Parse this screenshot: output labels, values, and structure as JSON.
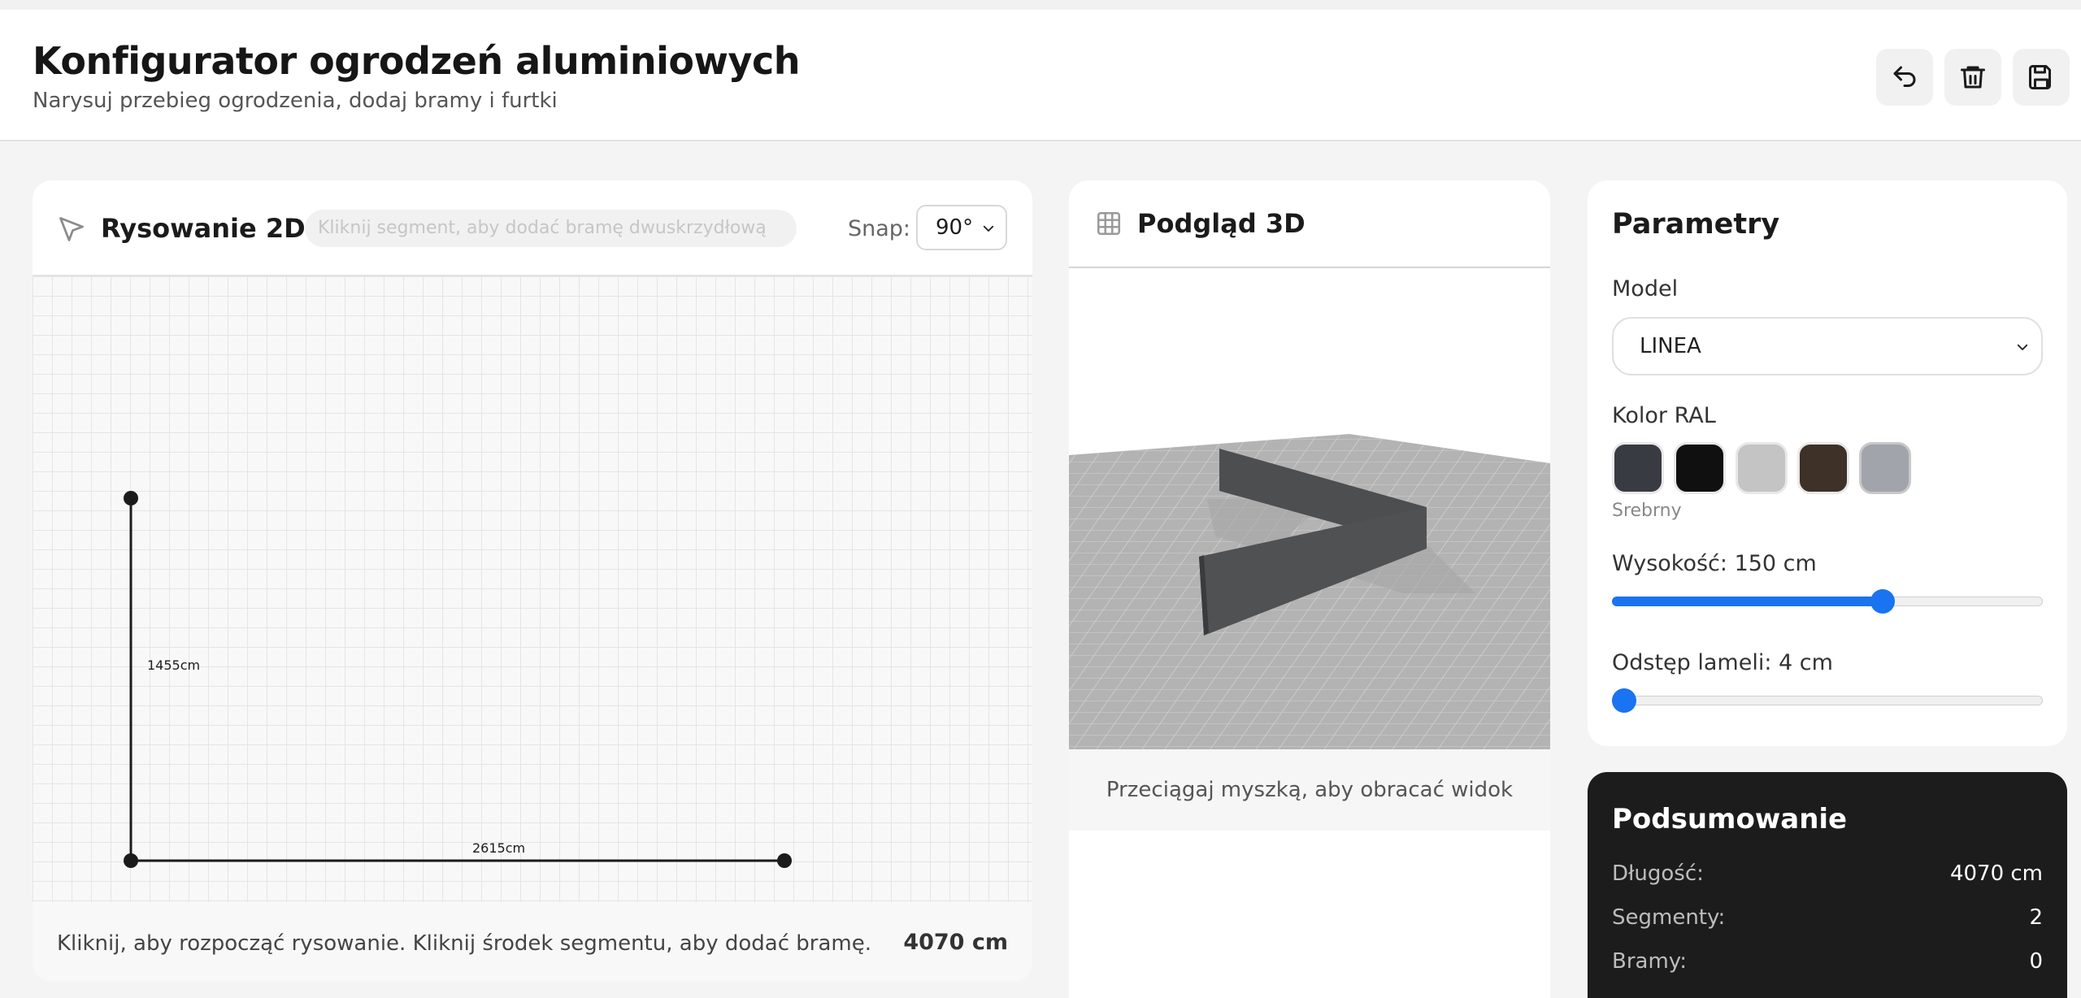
{
  "header": {
    "title": "Konfigurator ogrodzeń aluminiowych",
    "subtitle": "Narysuj przebieg ogrodzenia, dodaj bramy i furtki"
  },
  "icons": {
    "undo": "undo-icon",
    "delete": "trash-icon",
    "save": "save-icon",
    "draw": "cursor-arrow-icon",
    "preview": "grid-icon"
  },
  "draw_panel": {
    "title": "Rysowanie 2D",
    "hint": "Kliknij segment, aby dodać bramę dwuskrzydłową",
    "snap_label": "Snap:",
    "snap_value": "90°",
    "segments": [
      {
        "label": "1455cm"
      },
      {
        "label": "2615cm"
      }
    ],
    "footer_text": "Kliknij, aby rozpocząć rysowanie. Kliknij środek segmentu, aby dodać bramę.",
    "total": "4070 cm"
  },
  "preview_panel": {
    "title": "Podgląd 3D",
    "footer_text": "Przeciągaj myszką, aby obracać widok"
  },
  "params": {
    "title": "Parametry",
    "model_label": "Model",
    "model_value": "LINEA",
    "color_label": "Kolor RAL",
    "colors": [
      "#383c42",
      "#101010",
      "#c4c4c4",
      "#3d3128",
      "#a1a4ab"
    ],
    "selected_color_index": 4,
    "color_name": "Srebrny",
    "height_label": "Wysokość: 150 cm",
    "height_fraction": 0.635,
    "gap_label": "Odstęp lameli: 4 cm",
    "gap_fraction": 0.0
  },
  "summary": {
    "title": "Podsumowanie",
    "rows": [
      {
        "key": "Długość:",
        "value": "4070 cm"
      },
      {
        "key": "Segmenty:",
        "value": "2"
      },
      {
        "key": "Bramy:",
        "value": "0"
      }
    ]
  },
  "accent_color": "#1a73f0"
}
